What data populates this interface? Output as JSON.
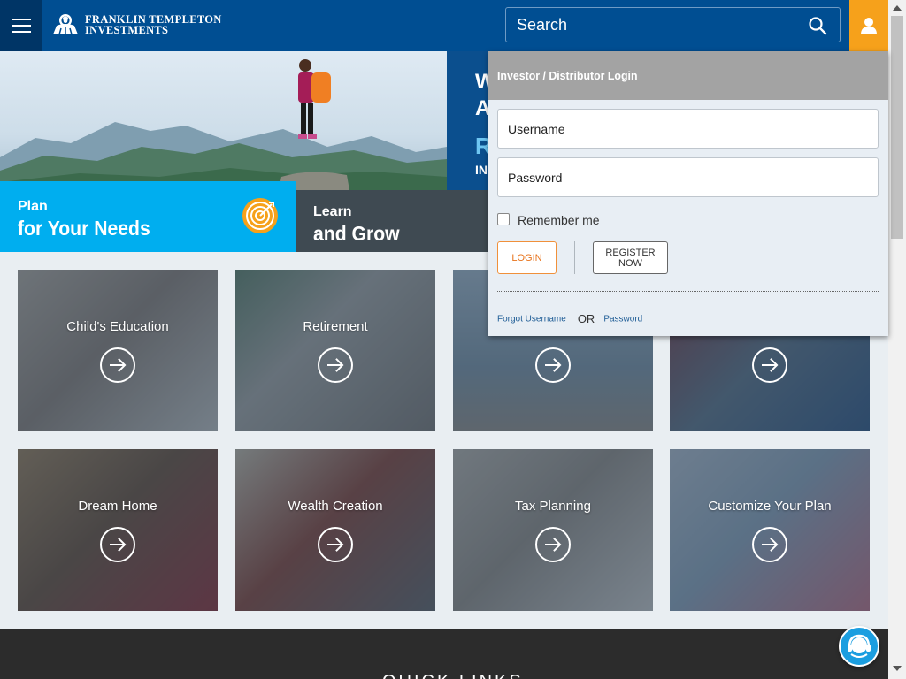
{
  "header": {
    "brand_line1": "FRANKLIN TEMPLETON",
    "brand_line2": "INVESTMENTS",
    "search_placeholder": "Search",
    "search_icon": "search-icon",
    "user_icon": "user-icon",
    "menu_icon": "hamburger-icon",
    "colors": {
      "bar": "#004e92",
      "user": "#f6a11b"
    }
  },
  "hero": {
    "headline_1": "W",
    "headline_2": "A",
    "headline_3": "R",
    "headline_4": "IN",
    "plan_small": "Plan",
    "plan_big": "for Your Needs",
    "plan_icon": "target-icon",
    "learn_small": "Learn",
    "learn_big": "and Grow",
    "colors": {
      "plan": "#00aeef",
      "learn": "#3f4a52"
    }
  },
  "cards": [
    {
      "title": "Child's Education",
      "arrow_icon": "arrow-right-icon"
    },
    {
      "title": "Retirement",
      "arrow_icon": "arrow-right-icon"
    },
    {
      "title": "",
      "arrow_icon": "arrow-right-icon"
    },
    {
      "title": "",
      "arrow_icon": "arrow-right-icon"
    },
    {
      "title": "Dream Home",
      "arrow_icon": "arrow-right-icon"
    },
    {
      "title": "Wealth Creation",
      "arrow_icon": "arrow-right-icon"
    },
    {
      "title": "Tax Planning",
      "arrow_icon": "arrow-right-icon"
    },
    {
      "title": "Customize Your Plan",
      "arrow_icon": "arrow-right-icon"
    }
  ],
  "login": {
    "title": "Investor / Distributor Login",
    "username_placeholder": "Username",
    "password_placeholder": "Password",
    "remember_label": "Remember me",
    "remember_checked": false,
    "login_label": "LOGIN",
    "register_label": "REGISTER NOW",
    "forgot_username": "Forgot Username",
    "or_text": "OR",
    "forgot_password": "Password",
    "colors": {
      "login_accent": "#e8731b",
      "link": "#1f5d96"
    }
  },
  "footer": {
    "title": "QUICK LINKS"
  },
  "chat": {
    "icon": "chat-support-icon"
  }
}
